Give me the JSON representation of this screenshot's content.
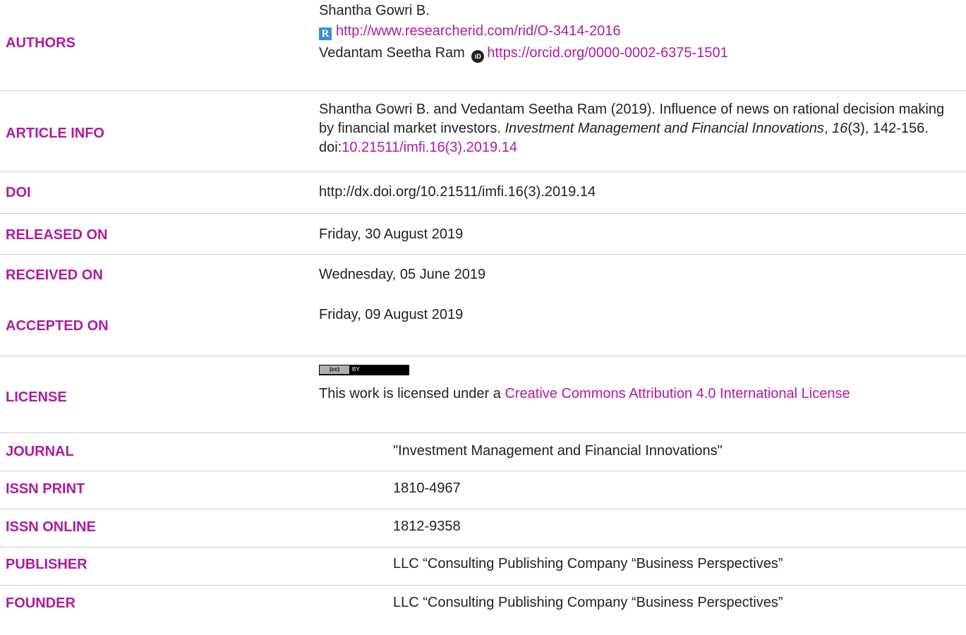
{
  "rows": {
    "authors": {
      "label": "AUTHORS",
      "author1_name": "Shantha Gowri B.",
      "author1_link": "http://www.researcherid.com/rid/O-3414-2016",
      "author2_name": "Vedantam Seetha Ram",
      "author2_link": "https://orcid.org/0000-0002-6375-1501"
    },
    "article_info": {
      "label": "ARTICLE INFO",
      "citation_prefix": "Shantha Gowri B. and Vedantam Seetha Ram (2019). Influence of news on rational decision making by financial market investors. ",
      "journal_italic": "Investment Management and Financial Innovations",
      "comma": ", ",
      "volume_italic": "16",
      "issue_pages": "(3), 142-156. doi:",
      "doi_link": "10.21511/imfi.16(3).2019.14"
    },
    "doi": {
      "label": "DOI",
      "value": "http://dx.doi.org/10.21511/imfi.16(3).2019.14"
    },
    "released": {
      "label": "RELEASED ON",
      "value": "Friday, 30 August 2019"
    },
    "received": {
      "label": "RECEIVED ON",
      "value": "Wednesday, 05 June 2019"
    },
    "accepted": {
      "label": "ACCEPTED ON",
      "value": "Friday, 09 August 2019"
    },
    "license": {
      "label": "LICENSE",
      "badge_cc": "(cc)",
      "badge_by": "BY",
      "text_prefix": "This work is licensed under a ",
      "link": "Creative Commons Attribution 4.0 International License"
    },
    "journal": {
      "label": "JOURNAL",
      "value": "\"Investment Management and Financial Innovations\""
    },
    "issn_print": {
      "label": "ISSN PRINT",
      "value": "1810-4967"
    },
    "issn_online": {
      "label": "ISSN ONLINE",
      "value": "1812-9358"
    },
    "publisher": {
      "label": "PUBLISHER",
      "value": "LLC “Consulting Publishing Company “Business Perspectives”"
    },
    "founder": {
      "label": "FOUNDER",
      "value": "LLC “Consulting Publishing Company “Business Perspectives”"
    }
  },
  "colors": {
    "label": "#b01a9f",
    "text": "#222222",
    "separator": "#cfcfcf"
  },
  "icons": {
    "researcherid": "researcherid-icon",
    "orcid": "orcid-icon",
    "license": "cc-by-badge"
  }
}
